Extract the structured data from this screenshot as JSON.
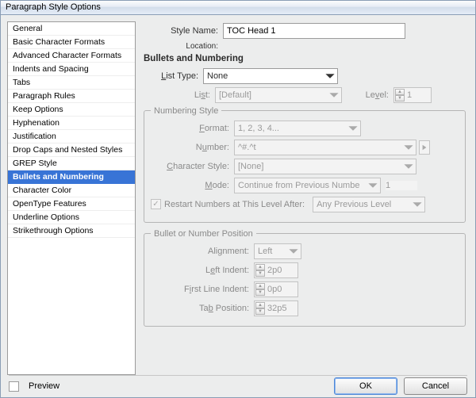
{
  "title": "Paragraph Style Options",
  "sidebar": {
    "selected": "Bullets and Numbering",
    "items": [
      "General",
      "Basic Character Formats",
      "Advanced Character Formats",
      "Indents and Spacing",
      "Tabs",
      "Paragraph Rules",
      "Keep Options",
      "Hyphenation",
      "Justification",
      "Drop Caps and Nested Styles",
      "GREP Style",
      "Bullets and Numbering",
      "Character Color",
      "OpenType Features",
      "Underline Options",
      "Strikethrough Options"
    ]
  },
  "header": {
    "style_name_label": "Style Name:",
    "style_name_value": "TOC Head 1",
    "location_label": "Location:",
    "section_title": "Bullets and Numbering"
  },
  "list": {
    "type_label": "List Type:",
    "type_value": "None",
    "list_label": "List:",
    "list_value": "[Default]",
    "level_label": "Level:",
    "level_value": "1"
  },
  "numbering": {
    "legend": "Numbering Style",
    "format_label": "Format:",
    "format_value": "1, 2, 3, 4...",
    "number_label": "Number:",
    "number_value": "^#.^t",
    "charstyle_label": "Character Style:",
    "charstyle_value": "[None]",
    "mode_label": "Mode:",
    "mode_value": "Continue from Previous Numbe",
    "mode_at": "1",
    "restart_label": "Restart Numbers at This Level After:",
    "restart_value": "Any Previous Level"
  },
  "position": {
    "legend": "Bullet or Number Position",
    "alignment_label": "Alignment:",
    "alignment_value": "Left",
    "left_indent_label": "Left Indent:",
    "left_indent_value": "2p0",
    "first_line_label": "First Line Indent:",
    "first_line_value": "0p0",
    "tab_position_label": "Tab Position:",
    "tab_position_value": "32p5"
  },
  "footer": {
    "preview_label": "Preview",
    "ok": "OK",
    "cancel": "Cancel"
  }
}
